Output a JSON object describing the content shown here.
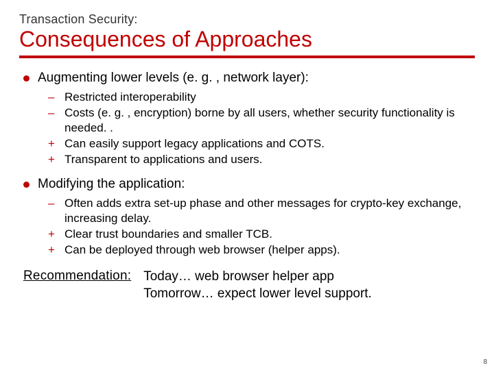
{
  "pretitle": "Transaction Security:",
  "title": "Consequences of Approaches",
  "sections": [
    {
      "heading": "Augmenting lower levels (e. g. , network layer):",
      "items": [
        {
          "mark": "–",
          "text": "Restricted interoperability"
        },
        {
          "mark": "–",
          "text": "Costs (e. g. , encryption) borne by all users, whether security functionality is needed. ."
        },
        {
          "mark": "+",
          "text": "Can easily support legacy applications and COTS."
        },
        {
          "mark": "+",
          "text": "Transparent to applications and users."
        }
      ]
    },
    {
      "heading": "Modifying the application:",
      "items": [
        {
          "mark": "–",
          "text": "Often adds extra set-up phase and other messages for crypto-key exchange, increasing delay."
        },
        {
          "mark": "+",
          "text": "Clear trust boundaries and smaller TCB."
        },
        {
          "mark": "+",
          "text": "Can be deployed through web browser (helper apps)."
        }
      ]
    }
  ],
  "recommendation": {
    "label": "Recommendation:",
    "lines": [
      "Today… web browser helper app",
      "Tomorrow… expect lower level support."
    ]
  },
  "page_number": "8"
}
